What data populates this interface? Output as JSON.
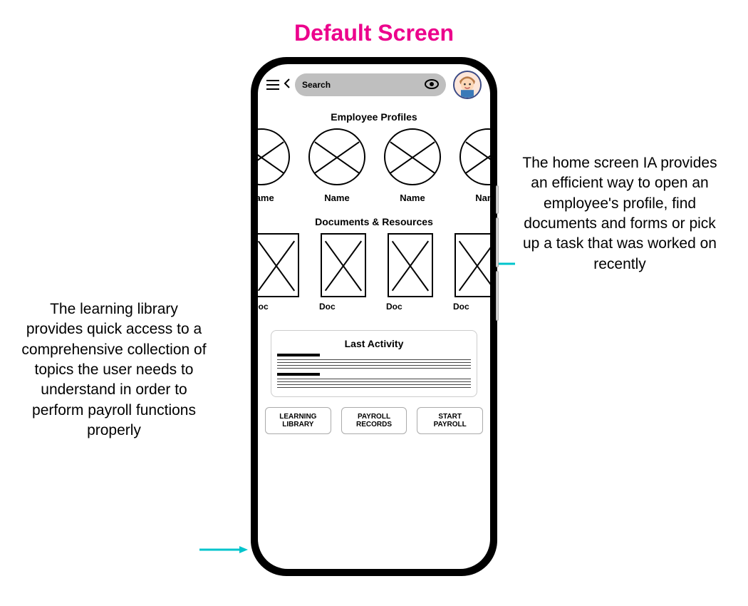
{
  "title": "Default Screen",
  "annotations": {
    "left": "The learning library provides quick access to a comprehensive collection of topics the user needs to understand in order to perform payroll functions properly",
    "right": "The home screen IA provides an efficient way to open an employee's profile, find documents and forms or pick up a task that was worked on recently"
  },
  "topbar": {
    "search_placeholder": "Search"
  },
  "sections": {
    "employee_profiles": {
      "title": "Employee Profiles",
      "items": [
        {
          "label": "Name"
        },
        {
          "label": "Name"
        },
        {
          "label": "Name"
        },
        {
          "label": "Name"
        }
      ]
    },
    "documents": {
      "title": "Documents & Resources",
      "items": [
        {
          "label": "Doc"
        },
        {
          "label": "Doc"
        },
        {
          "label": "Doc"
        },
        {
          "label": "Doc"
        }
      ]
    },
    "last_activity": {
      "title": "Last Activity"
    }
  },
  "footer": {
    "learning_library": "LEARNING\nLIBRARY",
    "payroll_records": "PAYROLL\nRECORDS",
    "start_payroll": "START\nPAYROLL"
  },
  "colors": {
    "title": "#ec008c",
    "arrow": "#00c4cc"
  }
}
